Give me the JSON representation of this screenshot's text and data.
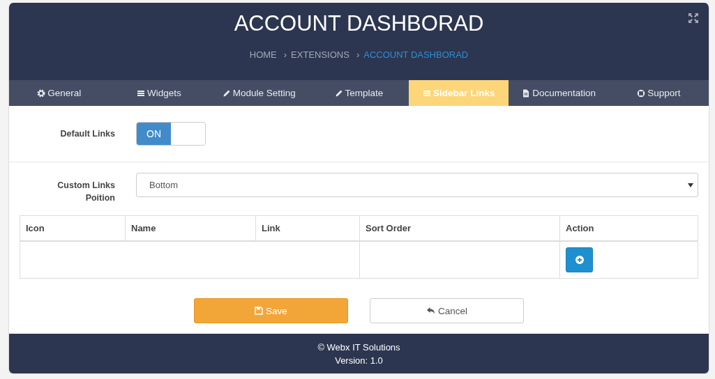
{
  "header": {
    "title": "ACCOUNT DASHBORAD",
    "separator": "›",
    "breadcrumb": [
      {
        "label": "HOME",
        "current": false
      },
      {
        "label": "EXTENSIONS",
        "current": false
      },
      {
        "label": "ACCOUNT DASHBORAD",
        "current": true
      }
    ]
  },
  "tabs": [
    {
      "label": "General",
      "selected": false
    },
    {
      "label": "Widgets",
      "selected": false
    },
    {
      "label": "Module Setting",
      "selected": false
    },
    {
      "label": "Template",
      "selected": false
    },
    {
      "label": "Sidebar Links",
      "selected": true
    },
    {
      "label": "Documentation",
      "selected": false
    },
    {
      "label": "Support",
      "selected": false
    }
  ],
  "default_links": {
    "label": "Default Links",
    "on": true,
    "toggle_text": "ON"
  },
  "custom_links_position": {
    "label": "Custom Links Poition",
    "value": "Bottom"
  },
  "table": {
    "columns": [
      "Icon",
      "Name",
      "Link",
      "Sort Order",
      "Action"
    ]
  },
  "buttons": [
    {
      "kind": "save",
      "label": "Save"
    },
    {
      "kind": "cancel",
      "label": "Cancel"
    }
  ],
  "footer": {
    "copyright": "© Webx IT Solutions",
    "version": "Version: 1.0"
  }
}
